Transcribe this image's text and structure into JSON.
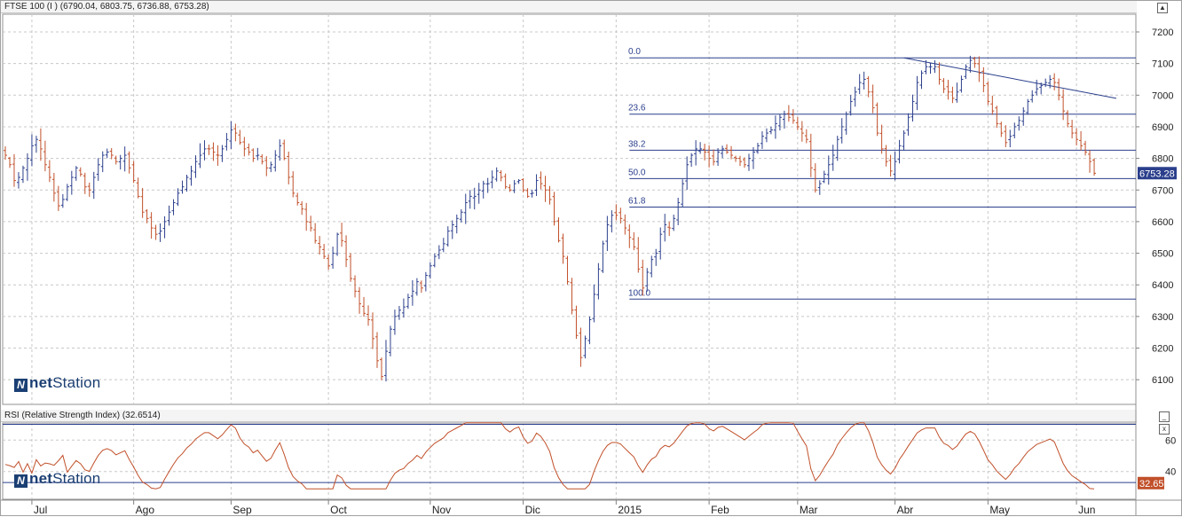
{
  "price_panel": {
    "title": "FTSE 100 (I ) (6790.04, 6803.75, 6736.88, 6753.28)",
    "last_label": "6753.28"
  },
  "rsi_panel": {
    "title": "RSI (Relative Strength Index) (32.6514)",
    "last_label": "32.65"
  },
  "logo": {
    "n": "N",
    "bold": "net",
    "rest": "Station"
  },
  "window_controls": {
    "scroll_up": "▲",
    "minimize": "_",
    "close": "x"
  },
  "colors": {
    "up": "#2b3f8c",
    "down": "#c1502a",
    "rsi_line": "#c1502a",
    "fib_line": "#2b3f8c",
    "grid": "#c8c8c8",
    "price_badge": "#2b3f8c",
    "rsi_badge": "#c1502a"
  },
  "chart_data": [
    {
      "type": "ohlc",
      "ylim": [
        6000,
        7250
      ],
      "yticks": [
        6100,
        6200,
        6300,
        6400,
        6500,
        6600,
        6700,
        6800,
        6900,
        7000,
        7100,
        7200
      ],
      "months": [
        {
          "label": "Jul",
          "index": 6
        },
        {
          "label": "Ago",
          "index": 29
        },
        {
          "label": "Sep",
          "index": 51
        },
        {
          "label": "Oct",
          "index": 73
        },
        {
          "label": "Nov",
          "index": 96
        },
        {
          "label": "Dic",
          "index": 117
        },
        {
          "label": "2015",
          "index": 138
        },
        {
          "label": "Feb",
          "index": 159
        },
        {
          "label": "Mar",
          "index": 179
        },
        {
          "label": "Abr",
          "index": 201
        },
        {
          "label": "May",
          "index": 222
        },
        {
          "label": "Jun",
          "index": 242
        }
      ],
      "num_bars": 251,
      "close": [
        6810,
        6780,
        6730,
        6740,
        6770,
        6800,
        6840,
        6860,
        6830,
        6780,
        6740,
        6690,
        6650,
        6670,
        6710,
        6740,
        6770,
        6750,
        6710,
        6700,
        6740,
        6780,
        6810,
        6820,
        6810,
        6790,
        6800,
        6810,
        6770,
        6730,
        6680,
        6630,
        6610,
        6580,
        6560,
        6570,
        6600,
        6630,
        6660,
        6690,
        6710,
        6740,
        6760,
        6790,
        6810,
        6830,
        6830,
        6820,
        6810,
        6830,
        6860,
        6890,
        6880,
        6850,
        6830,
        6820,
        6800,
        6810,
        6790,
        6770,
        6780,
        6810,
        6840,
        6800,
        6740,
        6690,
        6660,
        6640,
        6600,
        6580,
        6540,
        6520,
        6490,
        6460,
        6500,
        6560,
        6540,
        6480,
        6420,
        6380,
        6340,
        6310,
        6290,
        6230,
        6160,
        6110,
        6190,
        6260,
        6300,
        6320,
        6330,
        6360,
        6380,
        6410,
        6390,
        6430,
        6460,
        6490,
        6510,
        6530,
        6570,
        6590,
        6610,
        6630,
        6660,
        6680,
        6680,
        6700,
        6720,
        6720,
        6740,
        6760,
        6740,
        6710,
        6700,
        6720,
        6730,
        6700,
        6680,
        6690,
        6730,
        6720,
        6700,
        6670,
        6600,
        6540,
        6490,
        6410,
        6320,
        6240,
        6170,
        6230,
        6290,
        6370,
        6450,
        6530,
        6590,
        6620,
        6620,
        6610,
        6580,
        6550,
        6520,
        6450,
        6390,
        6440,
        6480,
        6500,
        6560,
        6590,
        6580,
        6610,
        6660,
        6720,
        6780,
        6810,
        6830,
        6830,
        6820,
        6800,
        6790,
        6820,
        6830,
        6820,
        6810,
        6800,
        6790,
        6780,
        6800,
        6820,
        6840,
        6870,
        6880,
        6890,
        6910,
        6930,
        6940,
        6930,
        6920,
        6900,
        6880,
        6860,
        6770,
        6700,
        6720,
        6750,
        6780,
        6810,
        6860,
        6900,
        6940,
        6980,
        7010,
        7040,
        7050,
        7010,
        6960,
        6880,
        6830,
        6790,
        6760,
        6790,
        6840,
        6880,
        6930,
        6980,
        7040,
        7070,
        7090,
        7090,
        7090,
        7050,
        7020,
        7010,
        6990,
        7010,
        7050,
        7090,
        7110,
        7100,
        7070,
        7030,
        6980,
        6950,
        6910,
        6880,
        6850,
        6870,
        6900,
        6920,
        6950,
        6980,
        7000,
        7020,
        7030,
        7040,
        7050,
        7040,
        7000,
        6950,
        6910,
        6880,
        6860,
        6840,
        6820,
        6790,
        6753
      ],
      "fibonacci": {
        "levels": [
          {
            "label": "0.0",
            "price": 7118
          },
          {
            "label": "23.6",
            "price": 6940
          },
          {
            "label": "38.2",
            "price": 6826
          },
          {
            "label": "50.0",
            "price": 6736
          },
          {
            "label": "61.8",
            "price": 6646
          },
          {
            "label": "100.0",
            "price": 6355
          }
        ],
        "start_index": 141
      },
      "trendline": {
        "from": [
          203,
          7118
        ],
        "to": [
          251,
          6990
        ]
      },
      "last_price": 6753.28
    },
    {
      "type": "line",
      "name": "RSI",
      "ylim": [
        28,
        72
      ],
      "yticks": [
        40,
        60
      ],
      "hlines": [
        33,
        70
      ],
      "last_value": 32.65
    }
  ]
}
